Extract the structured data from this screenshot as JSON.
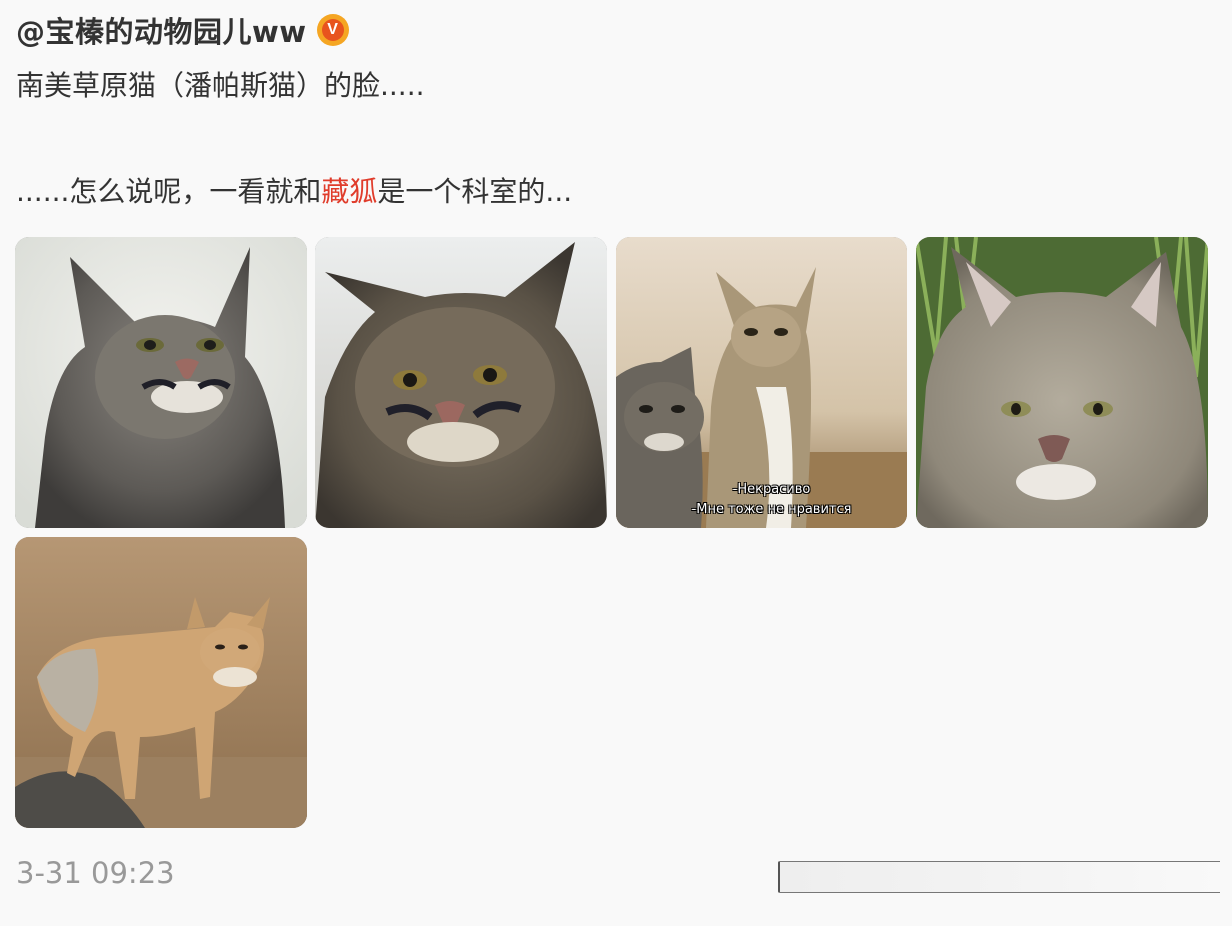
{
  "post": {
    "author": "@宝榛的动物园儿ww",
    "verified_badge": "V",
    "text_line1": "南美草原猫（潘帕斯猫）的脸.....",
    "text_line2_before": "......怎么说呢，一看就和",
    "text_line2_highlight": "藏狐",
    "text_line2_after": "是一个科室的...",
    "timestamp": "3-31 09:23"
  },
  "images": [
    {
      "subject": "pampas cat face, grey fur, white background"
    },
    {
      "subject": "pampas cat face close-up, dark ears"
    },
    {
      "subject": "pampas cat and tibetan fox side by side",
      "caption_line1": "-Некрасиво",
      "caption_line2": "-Мне тоже не нравится"
    },
    {
      "subject": "pampas cat face among green grass"
    },
    {
      "subject": "tibetan fox standing on rocky ground"
    }
  ],
  "colors": {
    "highlight": "#e03c2b",
    "badge_outer": "#f5a623",
    "badge_inner": "#e8541e",
    "timestamp": "#999999"
  }
}
